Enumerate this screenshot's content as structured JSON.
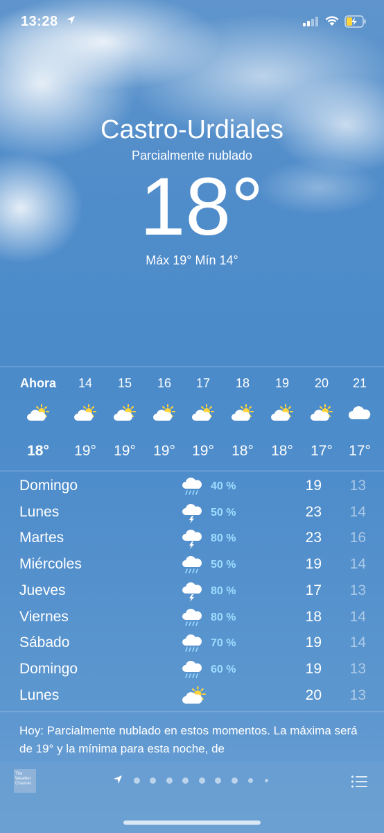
{
  "status_bar": {
    "time": "13:28",
    "icons": [
      "location-arrow-icon",
      "signal-icon",
      "wifi-icon",
      "battery-charging-icon"
    ]
  },
  "location": {
    "city": "Castro-Urdiales",
    "condition": "Parcialmente nublado",
    "temperature": "18°",
    "hi_lo": "Máx 19° Mín 14°"
  },
  "hourly": [
    {
      "label": "Ahora",
      "icon": "partly-sunny-icon",
      "temp": "18°"
    },
    {
      "label": "14",
      "icon": "partly-sunny-icon",
      "temp": "19°"
    },
    {
      "label": "15",
      "icon": "partly-sunny-icon",
      "temp": "19°"
    },
    {
      "label": "16",
      "icon": "partly-sunny-icon",
      "temp": "19°"
    },
    {
      "label": "17",
      "icon": "partly-sunny-icon",
      "temp": "19°"
    },
    {
      "label": "18",
      "icon": "partly-sunny-icon",
      "temp": "18°"
    },
    {
      "label": "19",
      "icon": "partly-sunny-icon",
      "temp": "18°"
    },
    {
      "label": "20",
      "icon": "partly-sunny-icon",
      "temp": "17°"
    },
    {
      "label": "21",
      "icon": "cloud-icon",
      "temp": "17°"
    }
  ],
  "daily": [
    {
      "day": "Domingo",
      "icon": "rain-cloud-icon",
      "prob": "40 %",
      "max": "19",
      "min": "13"
    },
    {
      "day": "Lunes",
      "icon": "thunder-cloud-icon",
      "prob": "50 %",
      "max": "23",
      "min": "14"
    },
    {
      "day": "Martes",
      "icon": "thunder-cloud-icon",
      "prob": "80 %",
      "max": "23",
      "min": "16"
    },
    {
      "day": "Miércoles",
      "icon": "rain-cloud-icon",
      "prob": "50 %",
      "max": "19",
      "min": "14"
    },
    {
      "day": "Jueves",
      "icon": "thunder-cloud-icon",
      "prob": "80 %",
      "max": "17",
      "min": "13"
    },
    {
      "day": "Viernes",
      "icon": "rain-cloud-icon",
      "prob": "80 %",
      "max": "18",
      "min": "14"
    },
    {
      "day": "Sábado",
      "icon": "rain-cloud-icon",
      "prob": "70 %",
      "max": "19",
      "min": "14"
    },
    {
      "day": "Domingo",
      "icon": "rain-cloud-icon",
      "prob": "60 %",
      "max": "19",
      "min": "13"
    },
    {
      "day": "Lunes",
      "icon": "partly-sunny-icon",
      "prob": "",
      "max": "20",
      "min": "13"
    }
  ],
  "summary": "Hoy: Parcialmente nublado en estos momentos. La máxima será de 19° y la mínima para esta noche, de",
  "footer": {
    "logo_text": "The Weather Channel",
    "page_count": 9,
    "active_page": 0,
    "list_icon": "list-icon"
  },
  "colors": {
    "sky_top": "#5f95cc",
    "sky_bottom": "#6aa0d4",
    "precip_text": "#9fdcff",
    "sun": "#ffd43a"
  }
}
